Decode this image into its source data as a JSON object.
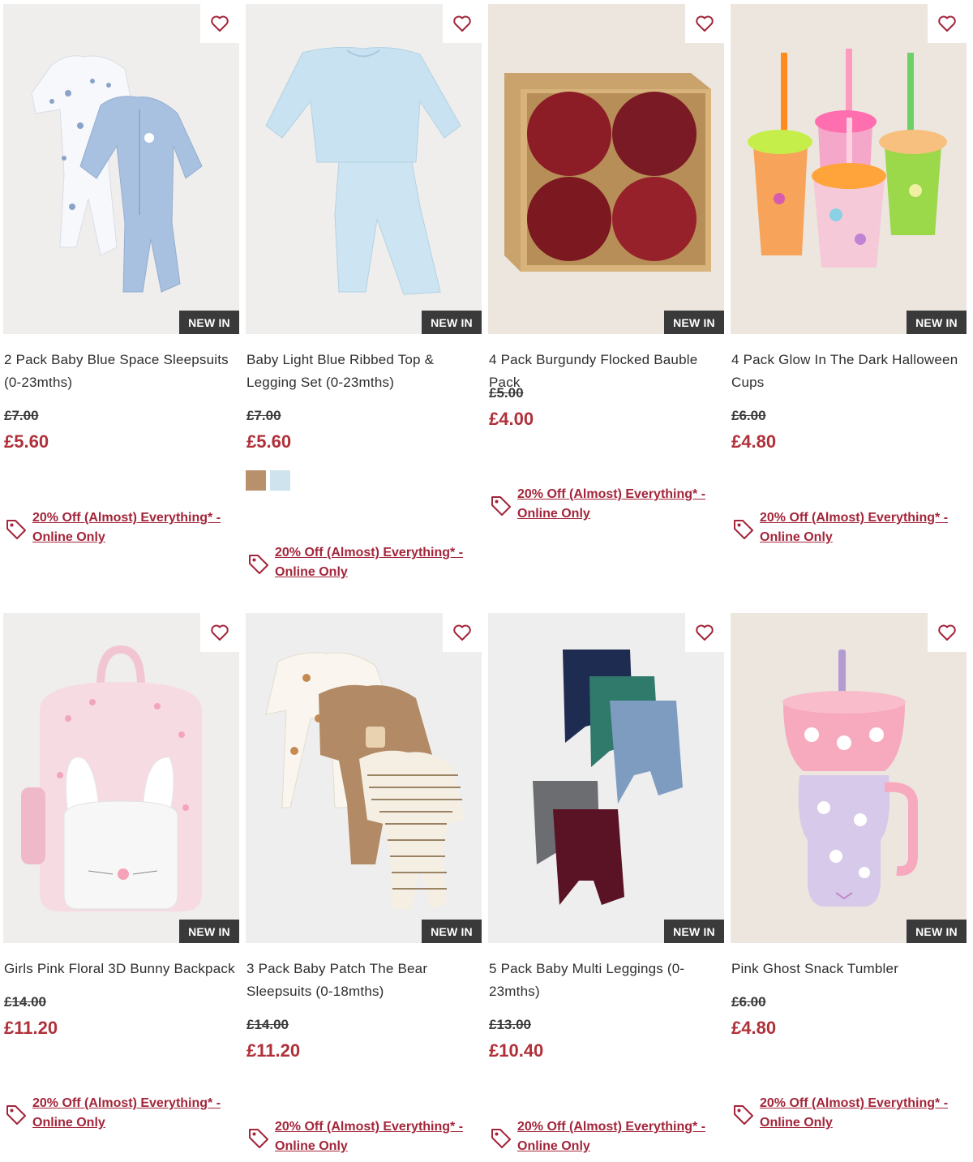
{
  "products": [
    {
      "name": "2 Pack Baby Blue Space Sleepsuits (0-23mths)",
      "was": "£7.00",
      "now": "£5.60",
      "badge": "NEW IN",
      "promo": "20% Off (Almost) Everything* - Online Only"
    },
    {
      "name": "Baby Light Blue Ribbed Top & Legging Set (0-23mths)",
      "was": "£7.00",
      "now": "£5.60",
      "badge": "NEW IN",
      "promo": "20% Off (Almost) Everything* - Online Only",
      "swatches": [
        "#b8916c",
        "#cfe3ee"
      ]
    },
    {
      "name": "4 Pack Burgundy Flocked Bauble Pack",
      "was": "£5.00",
      "now": "£4.00",
      "badge": "NEW IN",
      "promo": "20% Off (Almost) Everything* - Online Only"
    },
    {
      "name": "4 Pack Glow In The Dark Halloween Cups",
      "was": "£6.00",
      "now": "£4.80",
      "badge": "NEW IN",
      "promo": "20% Off (Almost) Everything* - Online Only"
    },
    {
      "name": "Girls Pink Floral 3D Bunny Backpack",
      "was": "£14.00",
      "now": "£11.20",
      "badge": "NEW IN",
      "promo": "20% Off (Almost) Everything* - Online Only"
    },
    {
      "name": "3 Pack Baby Patch The Bear Sleepsuits (0-18mths)",
      "was": "£14.00",
      "now": "£11.20",
      "badge": "NEW IN",
      "promo": "20% Off (Almost) Everything* - Online Only"
    },
    {
      "name": "5 Pack Baby Multi Leggings (0-23mths)",
      "was": "£13.00",
      "now": "£10.40",
      "badge": "NEW IN",
      "promo": "20% Off (Almost) Everything* - Online Only"
    },
    {
      "name": "Pink Ghost Snack Tumbler",
      "was": "£6.00",
      "now": "£4.80",
      "badge": "NEW IN",
      "promo": "20% Off (Almost) Everything* - Online Only"
    }
  ],
  "icons": {
    "wishlist": "heart-outline-icon",
    "promo": "price-tag-icon"
  },
  "colors": {
    "sale_price": "#b0303a",
    "promo_link": "#a3253a",
    "badge_bg": "#3a3a3a",
    "wishlist": "#a3253a"
  }
}
